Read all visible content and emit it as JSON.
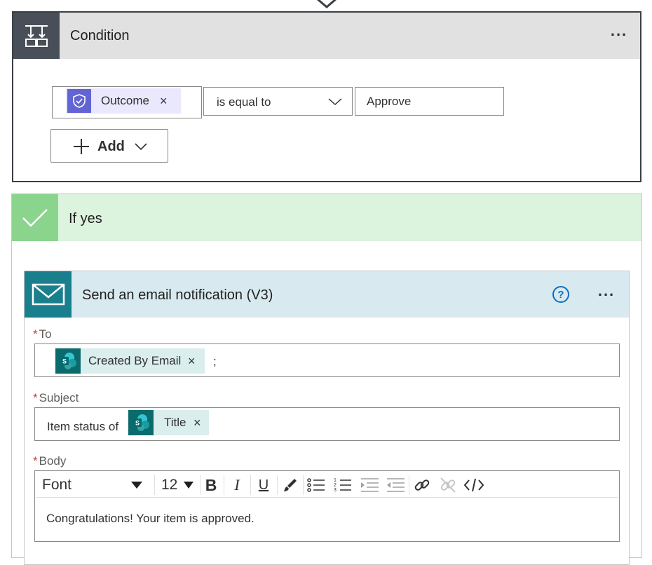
{
  "condition": {
    "title": "Condition",
    "menu_label": "...",
    "left_operand": {
      "token_label": "Outcome",
      "remove_symbol": "×"
    },
    "operator": "is equal to",
    "right_operand": "Approve",
    "add_button_label": "Add"
  },
  "if_yes": {
    "title": "If yes"
  },
  "email_action": {
    "title": "Send an email notification (V3)",
    "help_symbol": "?",
    "menu_label": "...",
    "required_mark": "*",
    "to": {
      "label": "To",
      "token_label": "Created By Email",
      "remove_symbol": "×",
      "separator": ";"
    },
    "subject": {
      "label": "Subject",
      "prefix": "Item status of",
      "token_label": "Title",
      "remove_symbol": "×"
    },
    "body": {
      "label": "Body",
      "toolbar": {
        "font": "Font",
        "size": "12",
        "bold": "B",
        "italic": "I",
        "underline": "U"
      },
      "text": "Congratulations! Your item is approved."
    }
  },
  "colors": {
    "condition_header_bg": "#e1e1e1",
    "condition_icon_bg": "#484f58",
    "if_yes_header_bg": "#dcf3dd",
    "if_yes_icon_bg": "#8bd48e",
    "email_header_bg": "#d8eaf0",
    "email_icon_bg": "#1a7f8c",
    "approval_icon_bg": "#6264d4",
    "sharepoint_icon_bg": "#0b6a6c",
    "required_mark": "#d13438",
    "help_icon": "#0f6cbd"
  },
  "icons": [
    "flow-connector-arrow-icon",
    "condition-icon",
    "more-options-icon",
    "approval-icon",
    "remove-icon",
    "chevron-down-icon",
    "plus-icon",
    "checkmark-icon",
    "mail-icon",
    "help-icon",
    "sharepoint-icon",
    "paint-brush-icon",
    "bulleted-list-icon",
    "numbered-list-icon",
    "increase-indent-icon",
    "decrease-indent-icon",
    "link-icon",
    "unlink-icon",
    "code-view-icon"
  ]
}
